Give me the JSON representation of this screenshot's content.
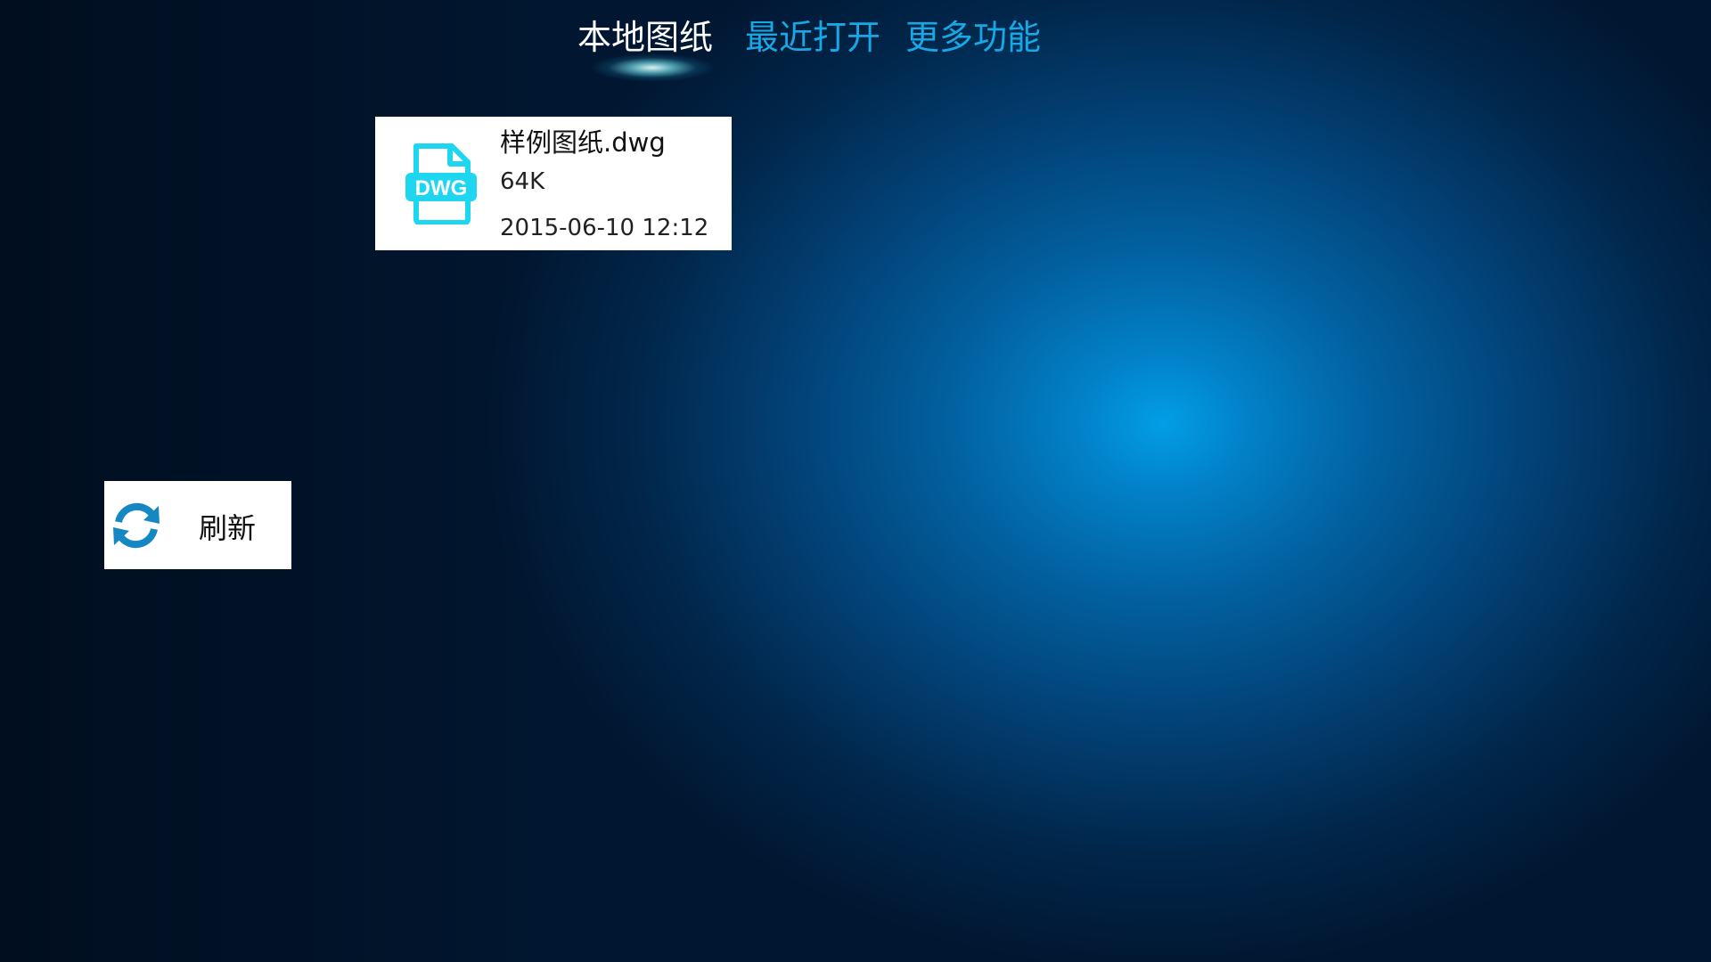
{
  "tabs": [
    {
      "label": "本地图纸",
      "active": true
    },
    {
      "label": "最近打开",
      "active": false
    },
    {
      "label": "更多功能",
      "active": false
    }
  ],
  "files": [
    {
      "name": "样例图纸.dwg",
      "size": "64K",
      "modified": "2015-06-10 12:12",
      "icon": "dwg-file-icon",
      "icon_text": "DWG"
    }
  ],
  "refresh": {
    "label": "刷新",
    "icon": "refresh-icon"
  },
  "colors": {
    "accent": "#18a8e6",
    "active_tab": "#ffffff",
    "icon_cyan": "#1fd6f0",
    "refresh_icon": "#1587c2",
    "background_center": "#029ee6",
    "background_edge": "#010f1f"
  }
}
